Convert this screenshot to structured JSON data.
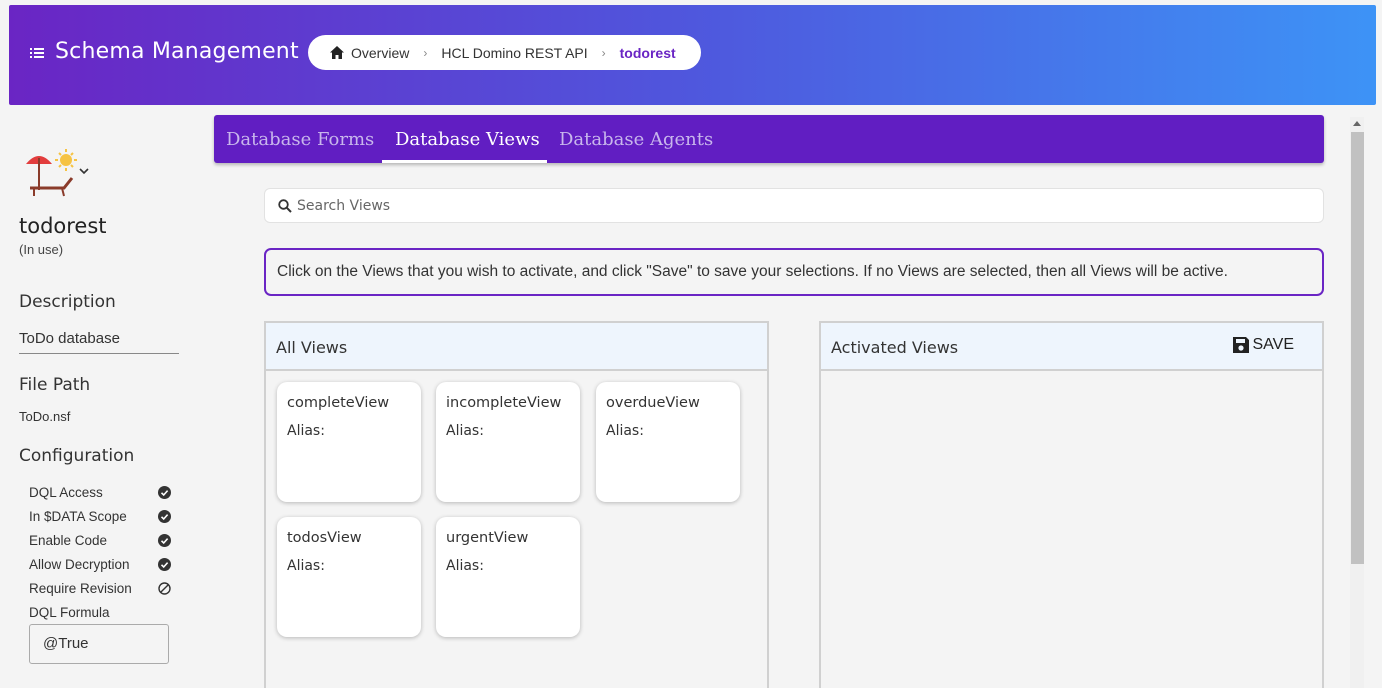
{
  "header": {
    "title": "Schema Management",
    "breadcrumb": [
      "Overview",
      "HCL Domino REST API",
      "todorest"
    ],
    "gradient": [
      "#6a25c4",
      "#3d93f6"
    ]
  },
  "sidebar": {
    "name": "todorest",
    "status": "(In use)",
    "description_label": "Description",
    "description_value": "ToDo database",
    "filepath_label": "File Path",
    "filepath_value": "ToDo.nsf",
    "config_label": "Configuration",
    "config": [
      {
        "label": "DQL Access",
        "icon": "check-circle-icon"
      },
      {
        "label": "In $DATA Scope",
        "icon": "check-circle-icon"
      },
      {
        "label": "Enable Code",
        "icon": "check-circle-icon"
      },
      {
        "label": "Allow Decryption",
        "icon": "check-circle-icon"
      },
      {
        "label": "Require Revision",
        "icon": "block-icon"
      },
      {
        "label": "DQL Formula",
        "icon": ""
      }
    ],
    "dql_formula": "@True"
  },
  "tabs": [
    "Database Forms",
    "Database Views",
    "Database Agents"
  ],
  "active_tab": "Database Views",
  "search": {
    "placeholder": "Search Views"
  },
  "info_text": "Click on the Views that you wish to activate, and click \"Save\" to save your selections. If no Views are selected, then all Views will be active.",
  "all_views": {
    "title": "All Views",
    "items": [
      {
        "name": "completeView",
        "alias": "Alias:"
      },
      {
        "name": "incompleteView",
        "alias": "Alias:"
      },
      {
        "name": "overdueView",
        "alias": "Alias:"
      },
      {
        "name": "todosView",
        "alias": "Alias:"
      },
      {
        "name": "urgentView",
        "alias": "Alias:"
      }
    ]
  },
  "activated_views": {
    "title": "Activated Views",
    "save_label": "SAVE"
  },
  "accent_color": "#6a25c4"
}
